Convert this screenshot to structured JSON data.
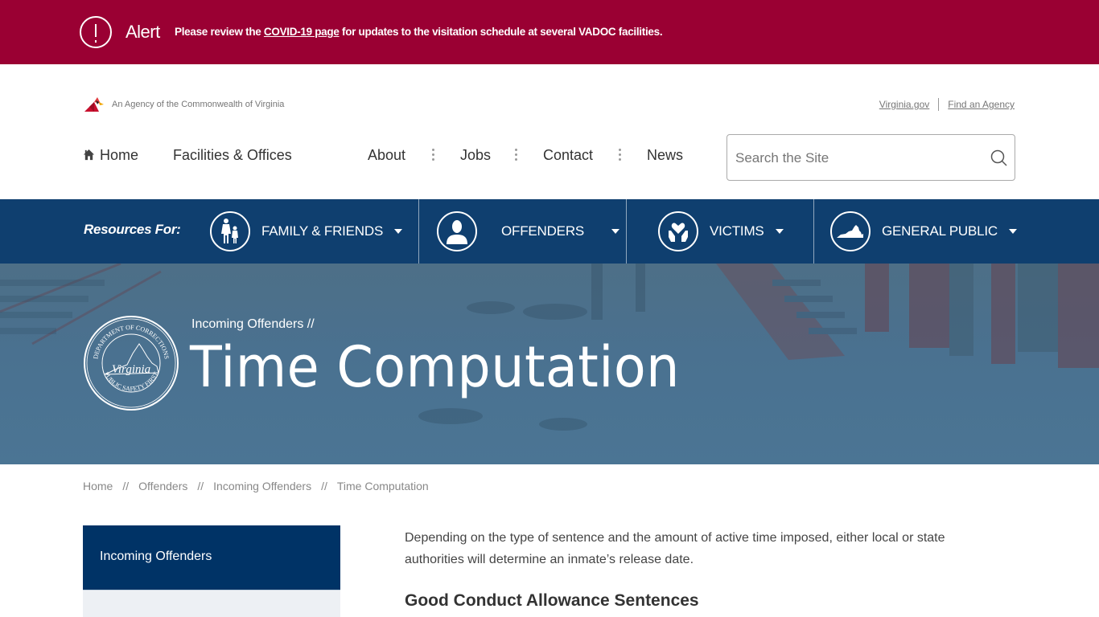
{
  "alert": {
    "icon": "exclamation-circle-icon",
    "label": "Alert",
    "message_before": "Please review the ",
    "link_text": "COVID-19 page",
    "message_after": " for updates to the visitation schedule at several VADOC facilities.",
    "background_color": "#9a0033"
  },
  "utility": {
    "agency_icon": "cardinal-logo-icon",
    "agency_text": "An Agency of the Commonwealth of Virginia",
    "links": [
      "Virginia.gov",
      "Find an Agency"
    ]
  },
  "nav": {
    "home": "Home",
    "facilities": "Facilities & Offices",
    "about": "About",
    "jobs": "Jobs",
    "contact": "Contact",
    "news": "News"
  },
  "search": {
    "placeholder": "Search the Site",
    "value": "",
    "icon": "search-icon"
  },
  "resources": {
    "label": "Resources For:",
    "background_color": "#0f3f6f",
    "items": [
      {
        "label": "FAMILY & FRIENDS",
        "icon": "family-icon"
      },
      {
        "label": "OFFENDERS",
        "icon": "person-icon"
      },
      {
        "label": "VICTIMS",
        "icon": "heart-hands-icon"
      },
      {
        "label": "GENERAL PUBLIC",
        "icon": "virginia-state-icon"
      }
    ]
  },
  "hero": {
    "parent_crumb": "Incoming Offenders  //",
    "title": "Time Computation",
    "seal": {
      "top_text": "DEPARTMENT OF CORRECTIONS",
      "center_text": "Virginia",
      "bottom_text": "PUBLIC SAFETY FIRST"
    }
  },
  "breadcrumb": {
    "items": [
      "Home",
      "Offenders",
      "Incoming Offenders",
      "Time Computation"
    ],
    "separator": "//"
  },
  "sidebar": {
    "active_item": "Incoming Offenders",
    "active_color": "#003366"
  },
  "content": {
    "intro": "Depending on the type of sentence and the amount of active time imposed, either local or state authorities will determine an inmate’s release date.",
    "heading": "Good Conduct Allowance Sentences"
  }
}
